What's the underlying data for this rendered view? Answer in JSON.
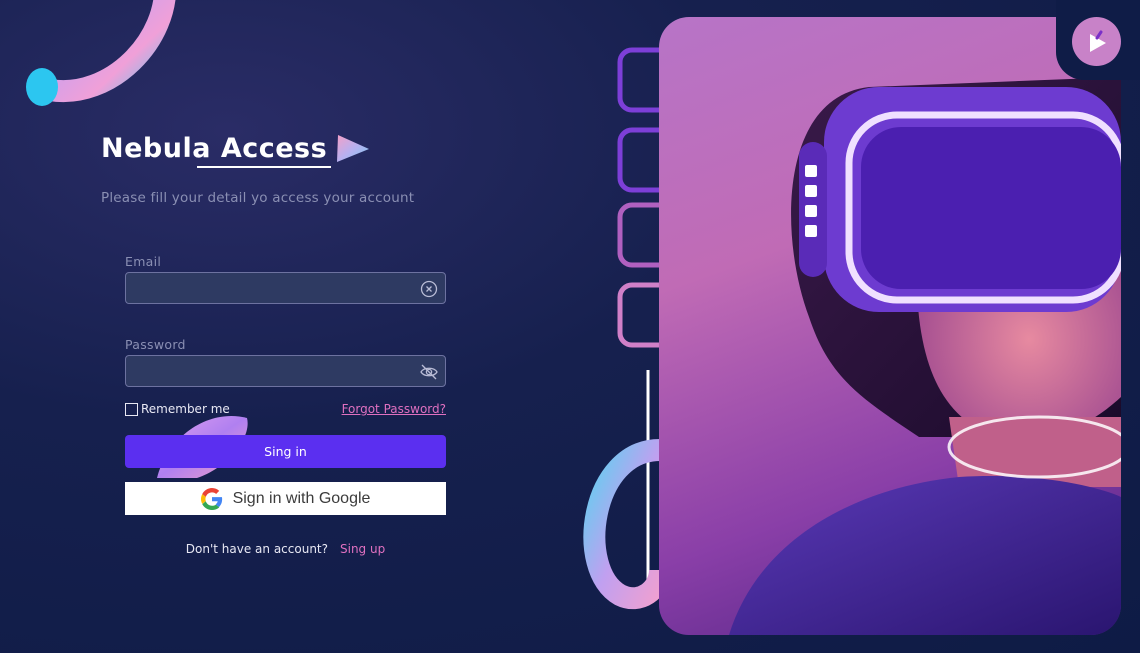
{
  "brand": {
    "name": "Nebula Access"
  },
  "subtitle": "Please fill your detail yo access your account",
  "form": {
    "email_label": "Email",
    "email_value": "",
    "password_label": "Password",
    "password_value": "",
    "remember_label": "Remember me",
    "forgot_label": "Forgot Password?",
    "signin_label": "Sing in",
    "google_label": "Sign in with Google",
    "no_account_text": "Don't have an account?",
    "signup_label": "Sing up"
  },
  "colors": {
    "background": "#16204e",
    "primary_button": "#5b2ff0",
    "link": "#e070c0",
    "input_bg": "#2e3a62"
  },
  "icons": {
    "email_clear": "clear-circle-icon",
    "password_toggle": "eye-off-icon",
    "google": "google-logo-icon",
    "brand_mark": "prism-icon",
    "badge": "vr-app-icon"
  }
}
